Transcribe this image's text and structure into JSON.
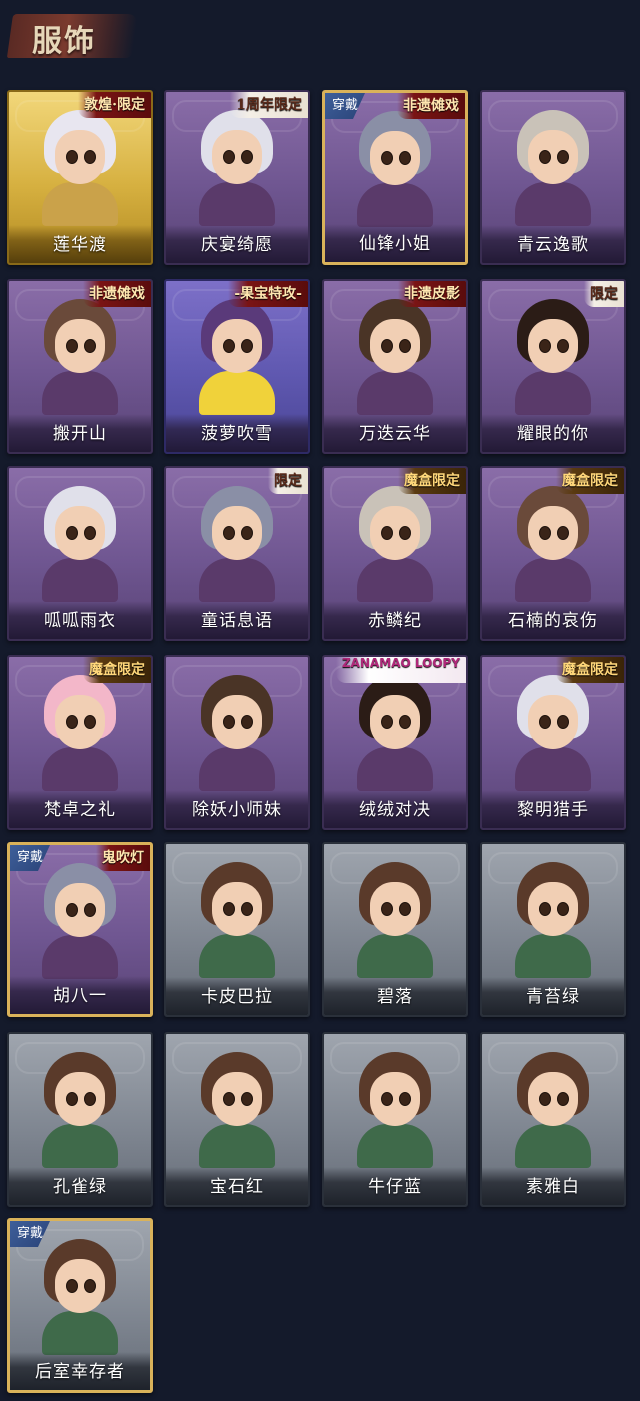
{
  "header": {
    "title": "服饰"
  },
  "worn_label": "穿戴",
  "colors": {
    "background": "#141a2b",
    "header_brush": "#6a3026",
    "title_text": "#e6d6b8",
    "card_purple": "#7a5f9c",
    "card_gray": "#868d97",
    "card_gold": "#d6b040",
    "worn_badge": "#2f4c85"
  },
  "costumes": [
    {
      "name": "莲华渡",
      "tag": "敦煌·限定",
      "worn": false,
      "tier": "gold"
    },
    {
      "name": "庆宴绮愿",
      "tag": "1周年限定",
      "worn": false,
      "tier": "purple"
    },
    {
      "name": "仙锋小姐",
      "tag": "非遗傩戏",
      "worn": true,
      "tier": "purple"
    },
    {
      "name": "青云逸歌",
      "tag": "",
      "worn": false,
      "tier": "purple"
    },
    {
      "name": "搬开山",
      "tag": "非遗傩戏",
      "worn": false,
      "tier": "purple"
    },
    {
      "name": "菠萝吹雪",
      "tag": "-果宝特攻-",
      "worn": false,
      "tier": "blue"
    },
    {
      "name": "万迭云华",
      "tag": "非遗皮影",
      "worn": false,
      "tier": "purple"
    },
    {
      "name": "耀眼的你",
      "tag": "限定",
      "worn": false,
      "tier": "purple"
    },
    {
      "name": "呱呱雨衣",
      "tag": "",
      "worn": false,
      "tier": "purple"
    },
    {
      "name": "童话息语",
      "tag": "限定",
      "worn": false,
      "tier": "purple"
    },
    {
      "name": "赤鳞纪",
      "tag": "魔盒限定",
      "worn": false,
      "tier": "purple"
    },
    {
      "name": "石楠的哀伤",
      "tag": "魔盒限定",
      "worn": false,
      "tier": "purple"
    },
    {
      "name": "梵卓之礼",
      "tag": "魔盒限定",
      "worn": false,
      "tier": "purple"
    },
    {
      "name": "除妖小师妹",
      "tag": "",
      "worn": false,
      "tier": "purple"
    },
    {
      "name": "绒绒对决",
      "tag": "ZANAMAO LOOPY",
      "worn": false,
      "tier": "purple"
    },
    {
      "name": "黎明猎手",
      "tag": "魔盒限定",
      "worn": false,
      "tier": "purple"
    },
    {
      "name": "胡八一",
      "tag": "鬼吹灯",
      "worn": true,
      "tier": "purple"
    },
    {
      "name": "卡皮巴拉",
      "tag": "",
      "worn": false,
      "tier": "gray"
    },
    {
      "name": "碧落",
      "tag": "",
      "worn": false,
      "tier": "gray"
    },
    {
      "name": "青苔绿",
      "tag": "",
      "worn": false,
      "tier": "gray"
    },
    {
      "name": "孔雀绿",
      "tag": "",
      "worn": false,
      "tier": "gray"
    },
    {
      "name": "宝石红",
      "tag": "",
      "worn": false,
      "tier": "gray"
    },
    {
      "name": "牛仔蓝",
      "tag": "",
      "worn": false,
      "tier": "gray"
    },
    {
      "name": "素雅白",
      "tag": "",
      "worn": false,
      "tier": "gray"
    },
    {
      "name": "后室幸存者",
      "tag": "",
      "worn": true,
      "tier": "gray"
    }
  ]
}
